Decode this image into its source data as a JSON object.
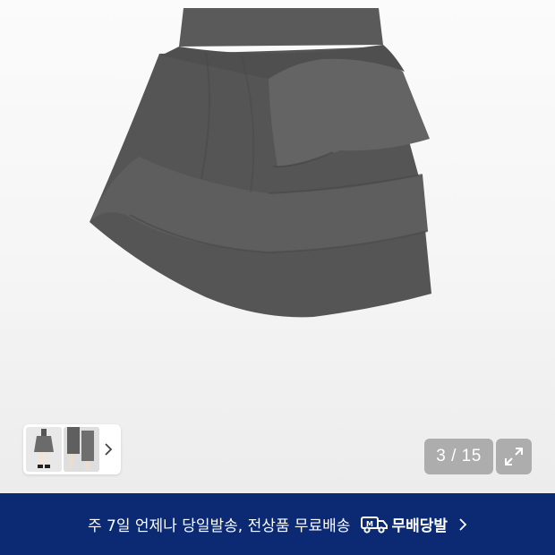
{
  "gallery": {
    "counter_text": "3 / 15",
    "product_image_icon": "skirt-product-photo",
    "skirt_color": "#5b5b5b",
    "thumbnail_next_icon": "chevron-right-icon",
    "expand_icon": "expand-arrows-icon"
  },
  "banner": {
    "text": "주 7일 언제나 당일발송, 전상품 무료배송",
    "badge_label": "무배당발",
    "badge_icon": "delivery-truck-icon",
    "chevron_icon": "chevron-right-icon",
    "background_color": "#0b2a73"
  }
}
